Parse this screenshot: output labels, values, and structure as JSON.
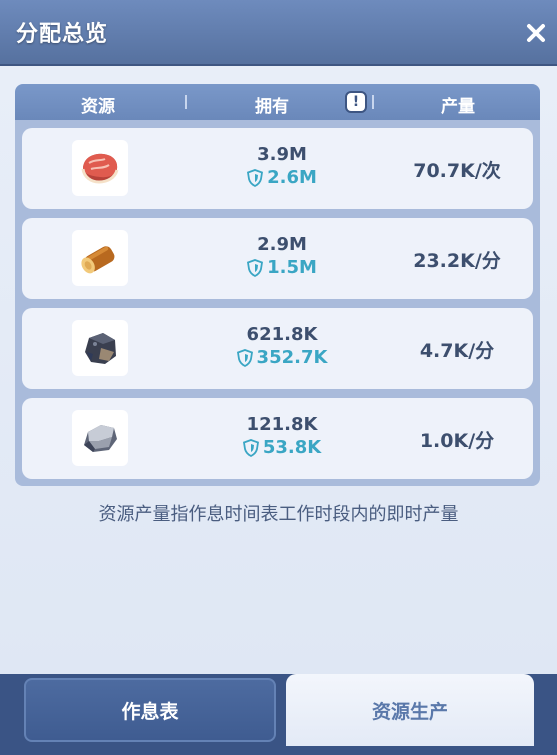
{
  "header": {
    "title": "分配总览"
  },
  "table": {
    "headers": {
      "resource": "资源",
      "owned": "拥有",
      "output": "产量"
    },
    "rows": [
      {
        "icon": "meat-icon",
        "owned": "3.9M",
        "protected": "2.6M",
        "rate": "70.7K/次"
      },
      {
        "icon": "wood-log-icon",
        "owned": "2.9M",
        "protected": "1.5M",
        "rate": "23.2K/分"
      },
      {
        "icon": "coal-ore-icon",
        "owned": "621.8K",
        "protected": "352.7K",
        "rate": "4.7K/分"
      },
      {
        "icon": "stone-icon",
        "owned": "121.8K",
        "protected": "53.8K",
        "rate": "1.0K/分"
      }
    ]
  },
  "note": "资源产量指作息时间表工作时段内的即时产量",
  "tabs": {
    "schedule": "作息表",
    "production": "资源生产"
  }
}
